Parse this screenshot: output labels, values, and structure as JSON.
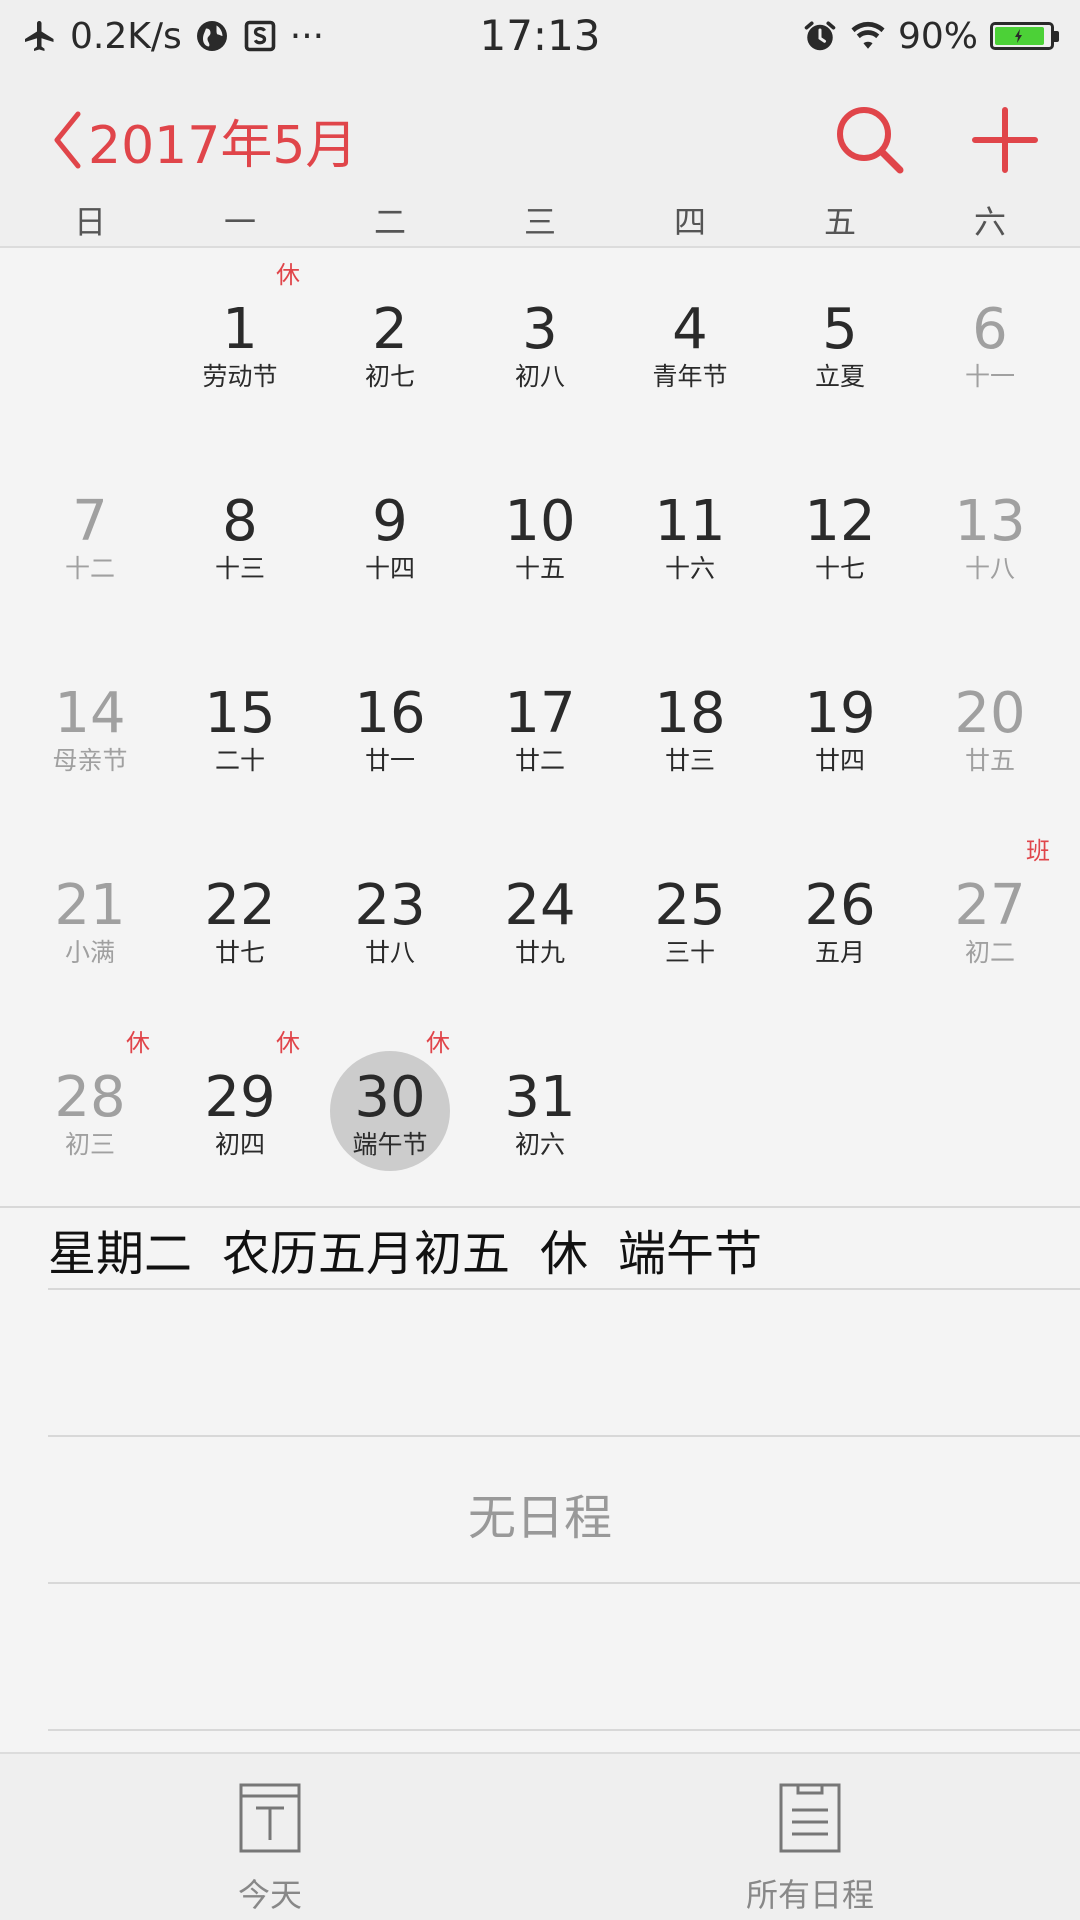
{
  "status_bar": {
    "network_speed": "0.2K/s",
    "more": "···",
    "time": "17:13",
    "battery": "90%",
    "icons": [
      "airplane-icon",
      "globe-icon",
      "s-app-icon",
      "more-icon",
      "alarm-icon",
      "wifi-icon",
      "battery-icon"
    ]
  },
  "header": {
    "title": "2017年5月",
    "accent_color": "#e0454a",
    "icons": [
      "chevron-left-icon",
      "search-icon",
      "plus-icon"
    ]
  },
  "weekdays": [
    "日",
    "一",
    "二",
    "三",
    "四",
    "五",
    "六"
  ],
  "calendar": {
    "weeks": [
      [
        null,
        {
          "day": "1",
          "sub": "劳动节",
          "badge": "休"
        },
        {
          "day": "2",
          "sub": "初七"
        },
        {
          "day": "3",
          "sub": "初八"
        },
        {
          "day": "4",
          "sub": "青年节"
        },
        {
          "day": "5",
          "sub": "立夏"
        },
        {
          "day": "6",
          "sub": "十一",
          "dim": true
        }
      ],
      [
        {
          "day": "7",
          "sub": "十二",
          "dim": true
        },
        {
          "day": "8",
          "sub": "十三"
        },
        {
          "day": "9",
          "sub": "十四"
        },
        {
          "day": "10",
          "sub": "十五"
        },
        {
          "day": "11",
          "sub": "十六"
        },
        {
          "day": "12",
          "sub": "十七"
        },
        {
          "day": "13",
          "sub": "十八",
          "dim": true
        }
      ],
      [
        {
          "day": "14",
          "sub": "母亲节",
          "dim": true
        },
        {
          "day": "15",
          "sub": "二十"
        },
        {
          "day": "16",
          "sub": "廿一"
        },
        {
          "day": "17",
          "sub": "廿二"
        },
        {
          "day": "18",
          "sub": "廿三"
        },
        {
          "day": "19",
          "sub": "廿四"
        },
        {
          "day": "20",
          "sub": "廿五",
          "dim": true
        }
      ],
      [
        {
          "day": "21",
          "sub": "小满",
          "dim": true
        },
        {
          "day": "22",
          "sub": "廿七"
        },
        {
          "day": "23",
          "sub": "廿八"
        },
        {
          "day": "24",
          "sub": "廿九"
        },
        {
          "day": "25",
          "sub": "三十"
        },
        {
          "day": "26",
          "sub": "五月"
        },
        {
          "day": "27",
          "sub": "初二",
          "dim": true,
          "badge": "班"
        }
      ],
      [
        {
          "day": "28",
          "sub": "初三",
          "dim": true,
          "badge": "休"
        },
        {
          "day": "29",
          "sub": "初四",
          "badge": "休"
        },
        {
          "day": "30",
          "sub": "端午节",
          "badge": "休",
          "selected": true
        },
        {
          "day": "31",
          "sub": "初六"
        },
        null,
        null,
        null
      ]
    ]
  },
  "detail": {
    "weekday": "星期二",
    "lunar": "农历五月初五",
    "status": "休",
    "festival": "端午节",
    "empty_text": "无日程"
  },
  "bottom_bar": {
    "today_label": "今天",
    "all_events_label": "所有日程",
    "icons": [
      "today-icon",
      "list-icon"
    ]
  }
}
